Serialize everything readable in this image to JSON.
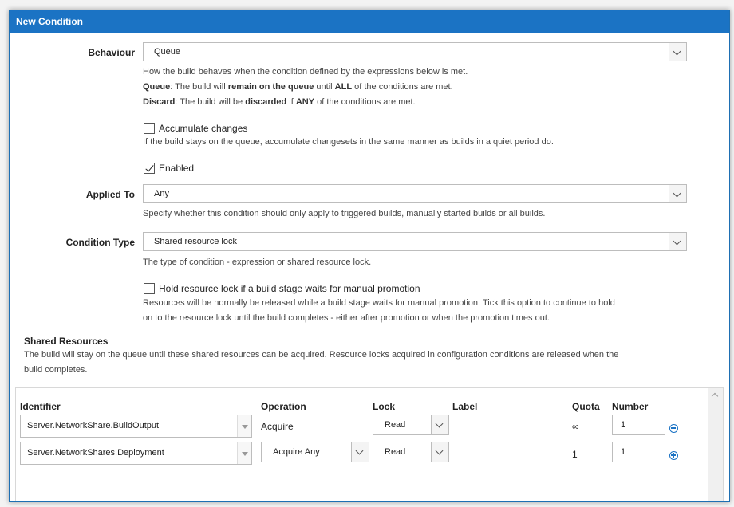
{
  "dialog": {
    "title": "New Condition"
  },
  "behaviour": {
    "label": "Behaviour",
    "value": "Queue",
    "help_line1": "How the build behaves when the condition defined by the expressions below is met.",
    "queue_term": "Queue",
    "queue_text1": ": The build will ",
    "queue_bold1": "remain on the queue",
    "queue_text2": " until ",
    "queue_bold2": "ALL",
    "queue_text3": " of the conditions are met.",
    "discard_term": "Discard",
    "discard_text1": ": The build will be ",
    "discard_bold1": "discarded",
    "discard_text2": " if ",
    "discard_bold2": "ANY",
    "discard_text3": " of the conditions are met."
  },
  "accumulate": {
    "label": "Accumulate changes",
    "checked": false,
    "help": "If the build stays on the queue, accumulate changesets in the same manner as builds in a quiet period do."
  },
  "enabled": {
    "label": "Enabled",
    "checked": true
  },
  "applied_to": {
    "label": "Applied To",
    "value": "Any",
    "help": "Specify whether this condition should only apply to triggered builds, manually started builds or all builds."
  },
  "condition_type": {
    "label": "Condition Type",
    "value": "Shared resource lock",
    "help": "The type of condition - expression or shared resource lock."
  },
  "hold_lock": {
    "label": "Hold resource lock if a build stage waits for manual promotion",
    "checked": false,
    "help_line1": "Resources will be normally be released while a build stage waits for manual promotion. Tick this option to continue to hold",
    "help_line2": "on to the resource lock until the build completes - either after promotion or when the promotion times out."
  },
  "shared_resources": {
    "heading": "Shared Resources",
    "help_line1": "The build will stay on the queue until these shared resources can be acquired. Resource locks acquired in configuration conditions are released when the",
    "help_line2": "build completes.",
    "columns": {
      "identifier": "Identifier",
      "operation": "Operation",
      "lock": "Lock",
      "label": "Label",
      "quota": "Quota",
      "number": "Number"
    },
    "rows": [
      {
        "identifier": "Server.NetworkShare.BuildOutput",
        "operation": "Acquire",
        "lock": "Read",
        "label": "",
        "quota": "∞",
        "number": "1",
        "action_icon": "remove-circle-icon"
      },
      {
        "identifier": "Server.NetworkShares.Deployment",
        "operation": "Acquire Any",
        "lock": "Read",
        "label": "",
        "quota": "1",
        "number": "1",
        "action_icon": "add-circle-icon"
      }
    ]
  },
  "colors": {
    "accent": "#1b73c4",
    "title_text": "#ffffff"
  }
}
